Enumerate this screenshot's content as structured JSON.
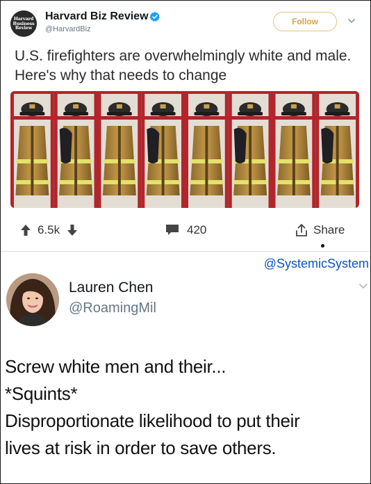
{
  "tweet": {
    "logo_lines": [
      "Harvard",
      "Business",
      "Review"
    ],
    "author_name": "Harvard Biz Review",
    "author_handle": "@HarvardBiz",
    "follow_label": "Follow",
    "text": "U.S. firefighters are overwhelmingly white and male. Here's why that needs to change",
    "actions": {
      "upvotes": "6.5k",
      "comments": "420",
      "share_label": "Share"
    }
  },
  "watermark": "@SystemicSystem",
  "reply": {
    "author_name": "Lauren Chen",
    "author_handle": "@RoamingMil",
    "lines": [
      "Screw white men and their...",
      "*Squints*",
      "Disproportionate likelihood to put their",
      "lives at risk in order to save others."
    ]
  },
  "colors": {
    "verified": "#1da1f2",
    "follow_border": "#e8c07a",
    "handle_gray": "#657786",
    "watermark_blue": "#0c54c4",
    "locker_red": "#b0262c"
  },
  "icons": {
    "verified": "verified-badge-icon",
    "caret": "chevron-down-icon",
    "upvote": "arrow-up-icon",
    "downvote": "arrow-down-icon",
    "comment": "speech-bubble-icon",
    "share": "share-upload-icon"
  }
}
